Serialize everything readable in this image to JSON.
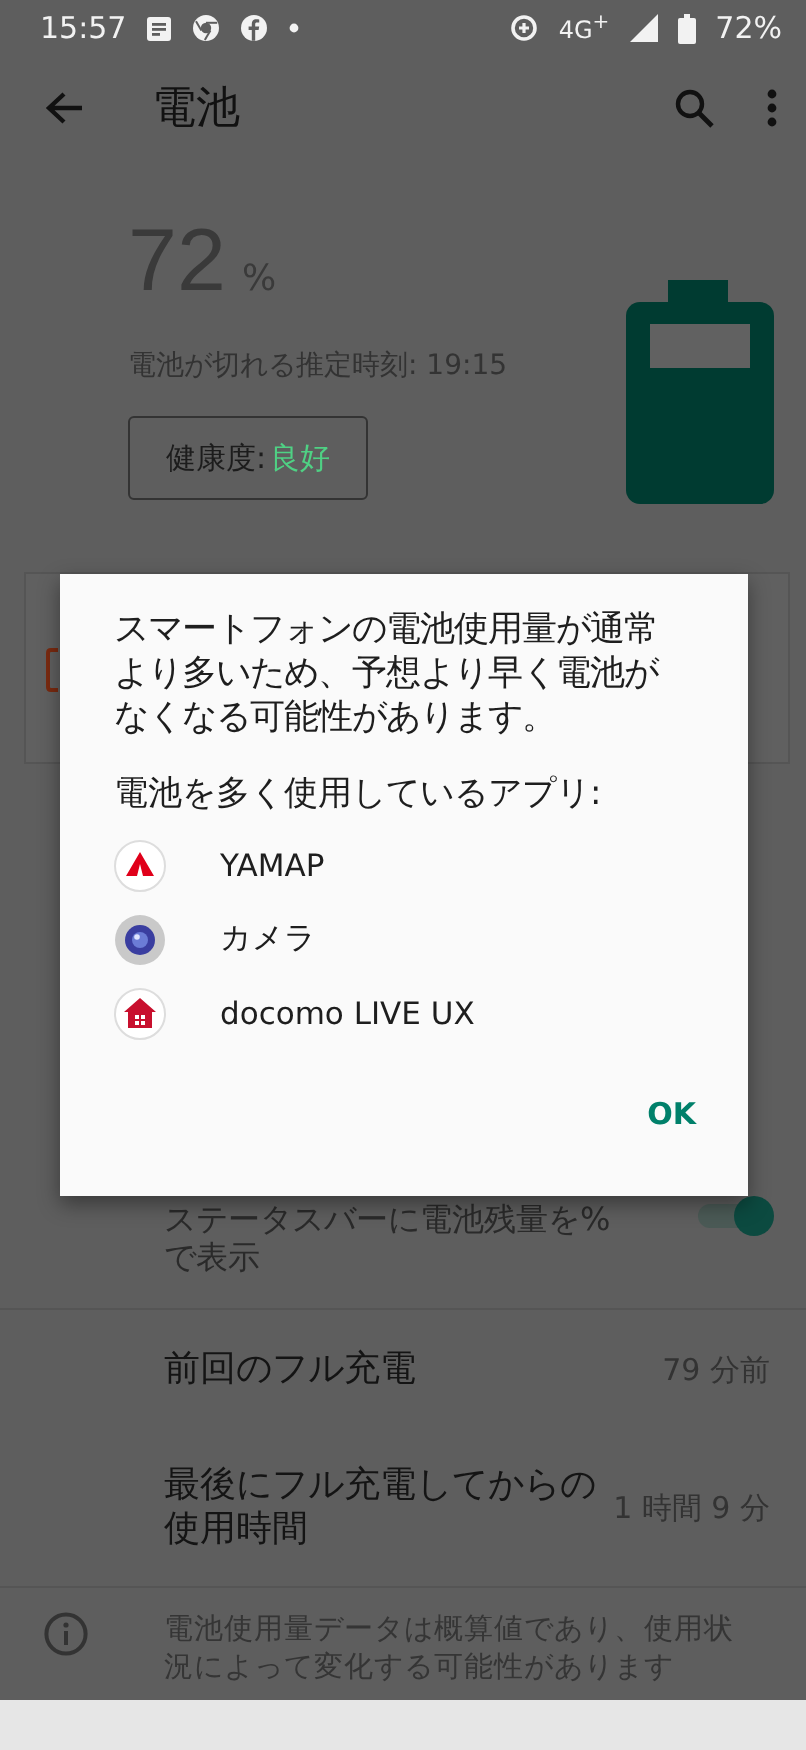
{
  "status_bar": {
    "time": "15:57",
    "network": "4G$^{+}$",
    "battery": "72%"
  },
  "toolbar": {
    "title": "電池"
  },
  "battery": {
    "percent": "72",
    "unit": "%",
    "estimate": "電池が切れる推定時刻: 19:15",
    "health_label": "健康度:",
    "health_value": "良好"
  },
  "settings": [
    {
      "kind": "toggle",
      "label": "ステータスバーに電池残量を%で表示",
      "on": true
    },
    {
      "kind": "info",
      "label": "前回のフル充電",
      "value": "79 分前"
    },
    {
      "kind": "info",
      "label": "最後にフル充電してからの使用時間",
      "value": "1 時間 9 分"
    }
  ],
  "footer": {
    "note": "電池使用量データは概算値であり、使用状況によって変化する可能性があります"
  },
  "dialog": {
    "message": "スマートフォンの電池使用量が通常より多いため、予想より早く電池がなくなる可能性があります。",
    "apps_heading": "電池を多く使用しているアプリ:",
    "apps": [
      {
        "kind": "yamap",
        "name": "YAMAP"
      },
      {
        "kind": "camera",
        "name": "カメラ"
      },
      {
        "kind": "home",
        "name": "docomo LIVE UX"
      }
    ],
    "button": "OK"
  }
}
